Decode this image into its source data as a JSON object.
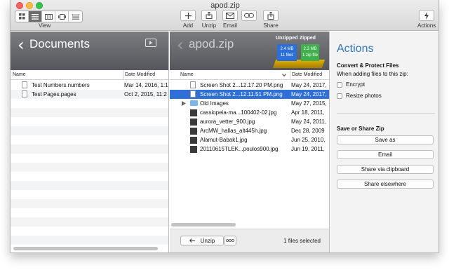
{
  "window": {
    "title": "apod.zip"
  },
  "toolbar": {
    "view_label": "View",
    "buttons": [
      {
        "label": "Add",
        "icon": "plus-icon"
      },
      {
        "label": "Unzip",
        "icon": "unzip-icon"
      },
      {
        "label": "Email",
        "icon": "envelope-icon"
      },
      {
        "label": "",
        "icon": "link-icon"
      },
      {
        "label": "Share",
        "icon": "share-icon"
      },
      {
        "label": "Actions",
        "icon": "lightning-icon"
      }
    ]
  },
  "left_pane": {
    "title": "Documents",
    "columns": {
      "name": "Name",
      "date": "Date Modified"
    },
    "files": [
      {
        "name": "Test Numbers.numbers",
        "date": "Mar 14, 2016, 1:1"
      },
      {
        "name": "Test Pages.pages",
        "date": "Oct 2, 2015, 11:2"
      }
    ]
  },
  "archive_pane": {
    "title": "apod.zip",
    "badges": {
      "unzipped_label": "Unzipped",
      "zipped_label": "Zipped",
      "unzipped_size": "2.4 MB",
      "unzipped_files": "11 files",
      "zipped_size": "2.3 MB",
      "zipped_files": "1 zip file"
    },
    "columns": {
      "name": "Name",
      "date": "Date Modified"
    },
    "files": [
      {
        "name": "Screen Shot 2...12.17.20 PM.png",
        "date": "May 24, 2017,",
        "kind": "file",
        "selected": false
      },
      {
        "name": "Screen Shot 2...12.11.51 PM.png",
        "date": "May 24, 2017,",
        "kind": "file",
        "selected": true
      },
      {
        "name": "Old Images",
        "date": "May 27, 2015,",
        "kind": "folder",
        "selected": false
      },
      {
        "name": "cassiopeia-ma...100402-02.jpg",
        "date": "Apr 18, 2011,",
        "kind": "image",
        "selected": false
      },
      {
        "name": "aurora_vetter_900.jpg",
        "date": "May 24, 2011,",
        "kind": "image",
        "selected": false
      },
      {
        "name": "ArcMW_hallas_alt445h.jpg",
        "date": "Dec 28, 2009",
        "kind": "image",
        "selected": false
      },
      {
        "name": "Alamut-Babak1.jpg",
        "date": "Jun 25, 2010,",
        "kind": "image",
        "selected": false
      },
      {
        "name": "20110615TLEK...poulos900.jpg",
        "date": "Jun 19, 2011,",
        "kind": "image",
        "selected": false
      }
    ],
    "unzip_button": "Unzip",
    "more_button": "ooo",
    "status": "1 files selected"
  },
  "actions_pane": {
    "title": "Actions",
    "convert_title": "Convert & Protect Files",
    "convert_subtitle": "When adding files to this zip:",
    "encrypt_label": "Encrypt",
    "resize_label": "Resize photos",
    "save_title": "Save or Share Zip",
    "save_as": "Save as",
    "email": "Email",
    "share_clipboard": "Share via clipboard",
    "share_elsewhere": "Share elsewhere"
  },
  "colors": {
    "accent_blue": "#2f6fd8",
    "actions_title": "#2d78c8",
    "unzipped_badge": "#2b6fd8",
    "zipped_badge": "#3fb04c"
  }
}
